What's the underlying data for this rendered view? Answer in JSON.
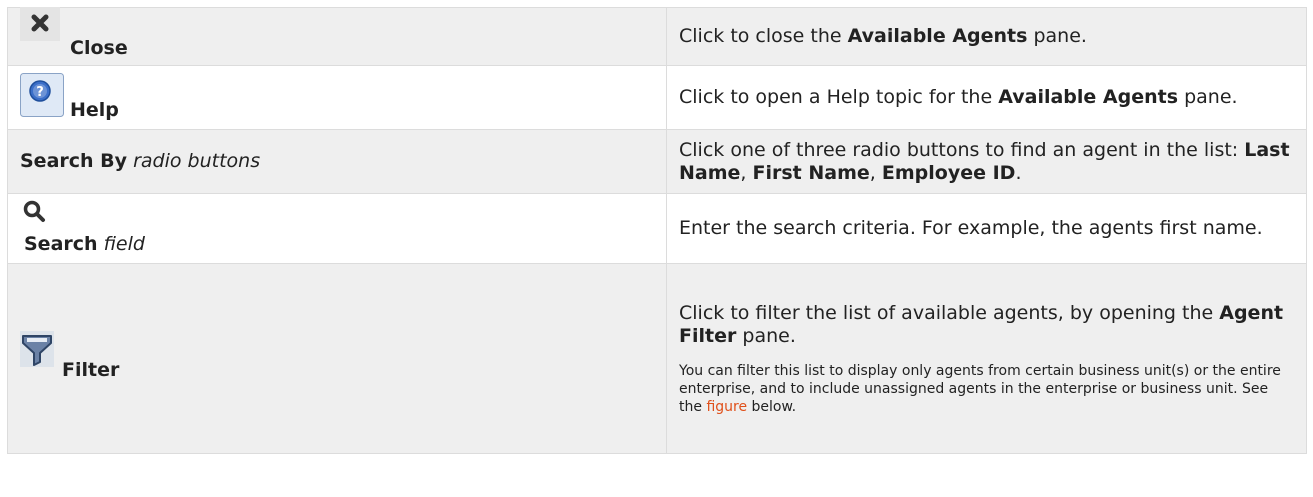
{
  "rows": [
    {
      "icon": "close-icon",
      "label": "Close",
      "desc": [
        "Click to close the ",
        "Available Agents",
        " pane."
      ]
    },
    {
      "icon": "help-icon",
      "label": "Help",
      "desc": [
        "Click to open a Help topic for the ",
        "Available Agents",
        " pane."
      ]
    },
    {
      "label": "Search By",
      "label_suffix": "radio buttons",
      "desc": [
        "Click one of three radio buttons to find an agent in the list: ",
        "Last Name",
        ", ",
        "First Name",
        ", ",
        "Employee ID",
        "."
      ]
    },
    {
      "icon": "search-icon",
      "label": "Search",
      "label_suffix": "field",
      "desc": [
        "Enter the search criteria.  For example, the agents first name."
      ]
    },
    {
      "icon": "filter-icon",
      "label": "Filter",
      "desc": [
        "Click to filter the list of available agents, by opening the ",
        "Agent Filter",
        " pane."
      ],
      "note": "You can filter this list to display only agents from certain business unit(s) or the entire enterprise, and to include unassigned agents in the enterprise or business unit. See the ",
      "note_link": "figure",
      "note_end": " below."
    }
  ]
}
